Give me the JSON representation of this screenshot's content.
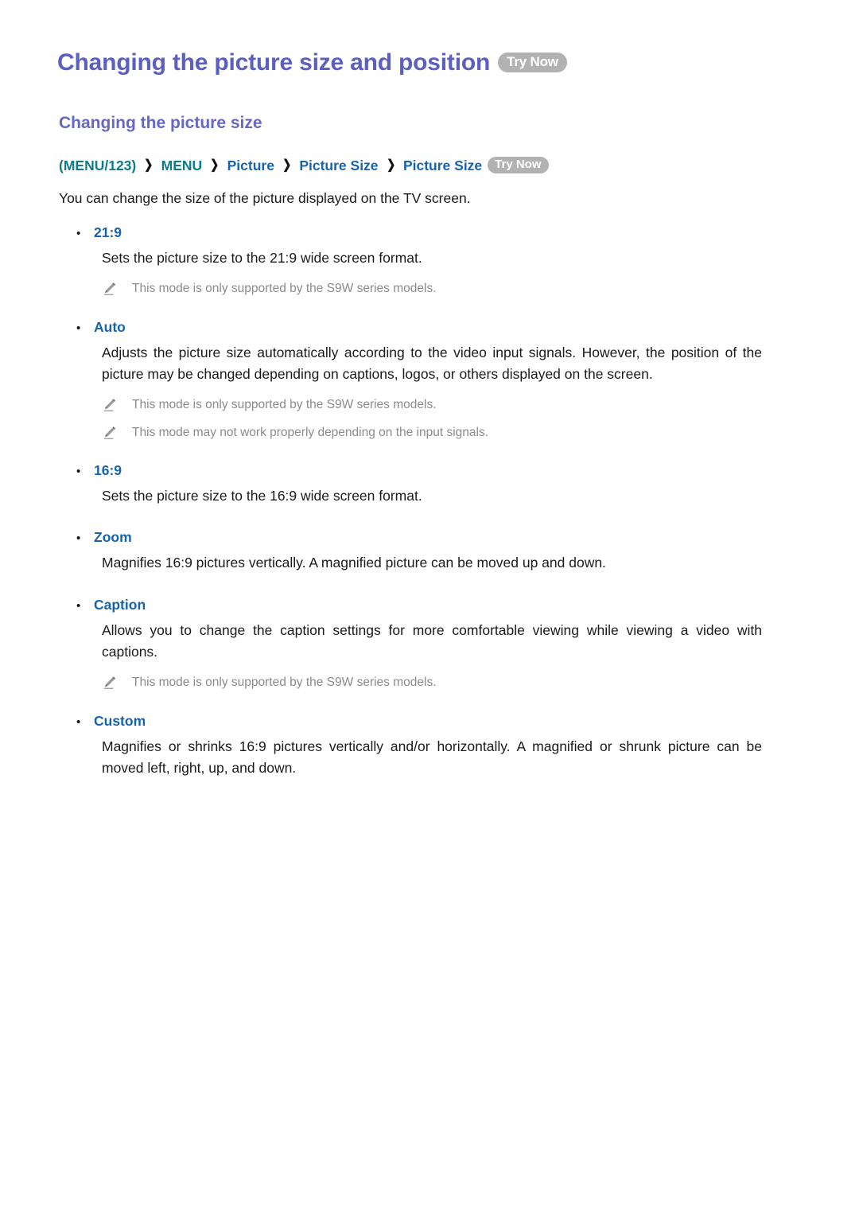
{
  "page": {
    "title": "Changing the picture size and position",
    "try_now_label": "Try Now",
    "sub_heading": "Changing the picture size",
    "intro": "You can change the size of the picture displayed on the TV screen."
  },
  "breadcrumb": {
    "separator": "❯",
    "items": [
      {
        "label": "(MENU/123)",
        "color": "teal"
      },
      {
        "label": "MENU",
        "color": "teal"
      },
      {
        "label": "Picture",
        "color": "blue"
      },
      {
        "label": "Picture Size",
        "color": "blue"
      },
      {
        "label": "Picture Size",
        "color": "blue"
      }
    ],
    "try_now_label": "Try Now"
  },
  "colors": {
    "title": "#5b5fc0",
    "sub_heading": "#6468c4",
    "breadcrumb_teal": "#0d7b8a",
    "breadcrumb_blue": "#1763ab",
    "option_label": "#1763ab",
    "body_text": "#1a1a1a",
    "note_text": "#8b8b8b",
    "try_now_bg": "#b2b2b2",
    "try_now_text": "#ffffff",
    "background": "#ffffff"
  },
  "options": [
    {
      "label": "21:9",
      "description": "Sets the picture size to the 21:9 wide screen format.",
      "notes": [
        "This mode is only supported by the S9W series models."
      ]
    },
    {
      "label": "Auto",
      "description": "Adjusts the picture size automatically according to the video input signals. However, the position of the picture may be changed depending on captions, logos, or others displayed on the screen.",
      "notes": [
        "This mode is only supported by the S9W series models.",
        "This mode may not work properly depending on the input signals."
      ]
    },
    {
      "label": "16:9",
      "description": "Sets the picture size to the 16:9 wide screen format.",
      "notes": []
    },
    {
      "label": "Zoom",
      "description": "Magnifies 16:9 pictures vertically. A magnified picture can be moved up and down.",
      "notes": []
    },
    {
      "label": "Caption",
      "description": "Allows you to change the caption settings for more comfortable viewing while viewing a video with captions.",
      "notes": [
        "This mode is only supported by the S9W series models."
      ]
    },
    {
      "label": "Custom",
      "description": "Magnifies or shrinks 16:9 pictures vertically and/or horizontally. A magnified or shrunk picture can be moved left, right, up, and down.",
      "notes": []
    }
  ],
  "icons": {
    "note": "pencil-icon",
    "bullet": "•"
  }
}
